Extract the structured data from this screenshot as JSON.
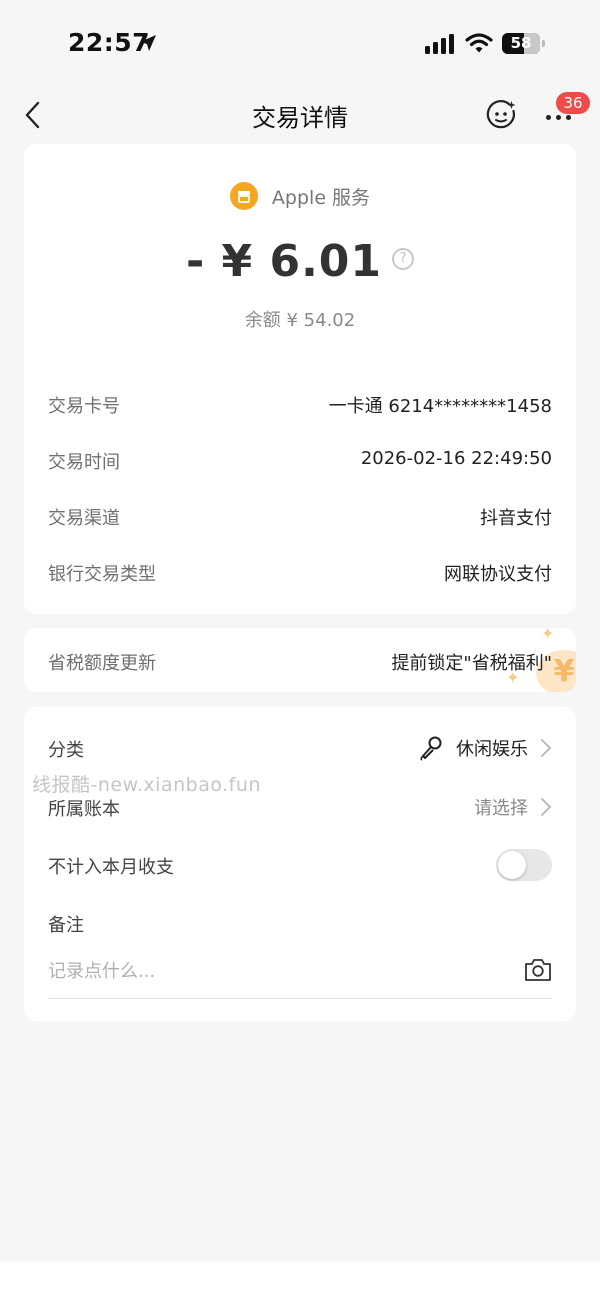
{
  "status_bar": {
    "time": "22:57",
    "battery": "58",
    "battery_level": 0.58
  },
  "nav": {
    "title": "交易详情",
    "badge": "36"
  },
  "transaction": {
    "merchant": "Apple 服务",
    "amount": "- ¥ 6.01",
    "balance": "余额 ¥ 54.02",
    "rows": [
      {
        "label": "交易卡号",
        "value": "一卡通 6214********1458"
      },
      {
        "label": "交易时间",
        "value": "2026-02-16 22:49:50"
      },
      {
        "label": "交易渠道",
        "value": "抖音支付"
      },
      {
        "label": "银行交易类型",
        "value": "网联协议支付"
      }
    ]
  },
  "tax": {
    "label": "省税额度更新",
    "value": "提前锁定\"省税福利\"",
    "coin_symbol": "¥"
  },
  "category": {
    "category_label": "分类",
    "category_value": "休闲娱乐",
    "account_label": "所属账本",
    "account_value": "请选择",
    "exclude_label": "不计入本月收支",
    "exclude_on": false,
    "note_label": "备注",
    "note_placeholder": "记录点什么..."
  },
  "watermark": "线报酷-new.xianbao.fun",
  "colors": {
    "accent": "#f5a623",
    "badge": "#ee4b4b",
    "background": "#f6f6f6"
  }
}
